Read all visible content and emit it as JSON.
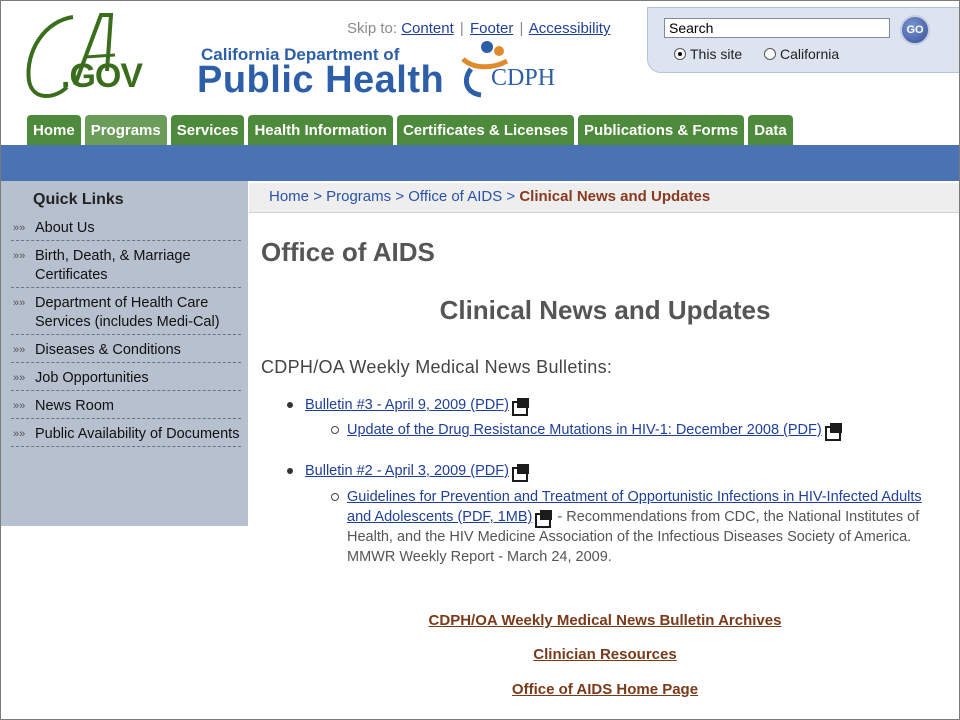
{
  "header": {
    "ca_gov": ".GOV",
    "dept_line1": "California Department of",
    "dept_line2": "Public Health",
    "cdph": "CDPH",
    "skip": {
      "label": "Skip to:",
      "content": "Content",
      "footer": "Footer",
      "accessibility": "Accessibility"
    }
  },
  "search": {
    "value": "Search",
    "go": "GO",
    "option_site": "This site",
    "option_ca": "California"
  },
  "tabs": [
    "Home",
    "Programs",
    "Services",
    "Health Information",
    "Certificates & Licenses",
    "Publications & Forms",
    "Data"
  ],
  "sidebar": {
    "title": "Quick Links",
    "items": [
      "About Us",
      "Birth, Death, & Marriage Certificates",
      "Department of Health Care Services (includes Medi-Cal)",
      "Diseases & Conditions",
      "Job Opportunities",
      "News Room",
      "Public Availability of Documents"
    ]
  },
  "breadcrumb": {
    "home": "Home",
    "programs": "Programs",
    "office": "Office of AIDS",
    "current": "Clinical News and Updates",
    "sep": ">"
  },
  "main": {
    "office_title": "Office of AIDS",
    "heading": "Clinical News and Updates",
    "bulletins_heading": "CDPH/OA Weekly Medical News Bulletins:",
    "bulletin3": "Bulletin #3 - April 9, 2009 (PDF)",
    "bulletin3_sub": "Update of the Drug Resistance Mutations in HIV-1: December 2008 (PDF)",
    "bulletin2": "Bulletin #2 - April 3, 2009 (PDF)",
    "bulletin2_sub_link": "Guidelines for Prevention and Treatment of Opportunistic Infections in HIV-Infected Adults and Adolescents (PDF, 1MB)",
    "bulletin2_sub_desc": "- Recommendations from CDC, the National Institutes of Health, and the HIV Medicine Association of the Infectious Diseases Society of America. MMWR Weekly Report - March 24, 2009.",
    "link_archives": "CDPH/OA Weekly Medical News Bulletin Archives",
    "link_clinician": "Clinician Resources",
    "link_home": "Office of AIDS Home Page"
  },
  "colors": {
    "tab_green": "#4e8a3c",
    "blue_bar": "#4a73b3",
    "sidebar_bg": "#b7c0cf",
    "link_brown": "#7a3a1a"
  }
}
